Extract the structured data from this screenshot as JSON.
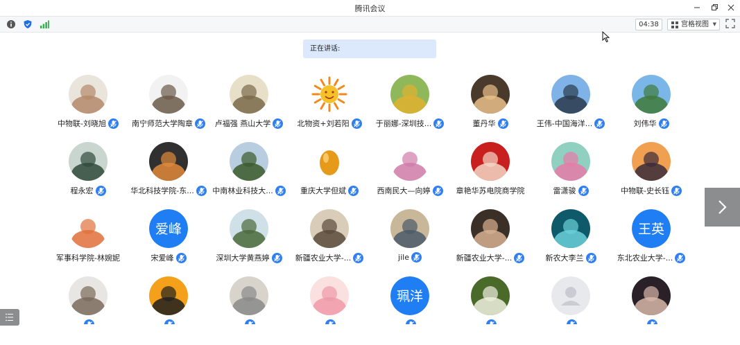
{
  "window": {
    "title": "腾讯会议"
  },
  "toolbar": {
    "timer": "04:38",
    "view_label": "宫格视图"
  },
  "speaking": {
    "label": "正在讲话:"
  },
  "participants": [
    {
      "name": "中物联-刘晓旭",
      "av": "photo",
      "c1": "#e9e4dc",
      "c2": "#b48a6a",
      "muted": true
    },
    {
      "name": "南宁师范大学陶章",
      "av": "photo",
      "c1": "#f2f2f2",
      "c2": "#6b5a49",
      "muted": true
    },
    {
      "name": "卢福强 燕山大学",
      "av": "photo",
      "c1": "#e8dfc8",
      "c2": "#7a6a4a",
      "muted": true
    },
    {
      "name": "北物资+刘若阳",
      "av": "sun",
      "c1": "#ffffff",
      "c2": "#f5a623",
      "muted": true
    },
    {
      "name": "于丽娜-深圳技...",
      "av": "photo",
      "c1": "#8fb85a",
      "c2": "#e0b030",
      "muted": true
    },
    {
      "name": "董丹华",
      "av": "photo",
      "c1": "#4a3a2c",
      "c2": "#e9c08a",
      "muted": true
    },
    {
      "name": "王伟-中国海洋...",
      "av": "photo",
      "c1": "#7fb3e8",
      "c2": "#2a3a4a",
      "muted": true
    },
    {
      "name": "刘伟华",
      "av": "photo",
      "c1": "#7ab7e8",
      "c2": "#3f7a3a",
      "muted": true
    },
    {
      "name": "程永宏",
      "av": "photo",
      "c1": "#c9d6cf",
      "c2": "#2f4a3a",
      "muted": true
    },
    {
      "name": "华北科技学院-东...",
      "av": "photo",
      "c1": "#303030",
      "c2": "#e08a3a",
      "muted": true
    },
    {
      "name": "中南林业科技大...",
      "av": "photo",
      "c1": "#b9cde0",
      "c2": "#3a5a2a",
      "muted": true
    },
    {
      "name": "重庆大学但斌",
      "av": "egg",
      "c1": "#ffffff",
      "c2": "#e59a1a",
      "muted": true
    },
    {
      "name": "西南民大—向婷",
      "av": "photo",
      "c1": "#ffffff",
      "c2": "#d07aa8",
      "muted": true
    },
    {
      "name": "章艳华苏电院商学院",
      "av": "photo",
      "c1": "#c8201f",
      "c2": "#f2d7c6",
      "muted": false
    },
    {
      "name": "雷潇骏",
      "av": "photo",
      "c1": "#8fd0c0",
      "c2": "#e87aa8",
      "muted": true
    },
    {
      "name": "中物联-史长钰",
      "av": "photo",
      "c1": "#f0a050",
      "c2": "#3a2a3a",
      "muted": true
    },
    {
      "name": "军事科学院-林婉妮",
      "av": "photo",
      "c1": "#ffffff",
      "c2": "#e0703a",
      "muted": false
    },
    {
      "name": "宋爱峰",
      "av": "text",
      "avtext": "爱峰",
      "c1": "#1f7ef4",
      "c2": "#ffffff",
      "muted": true
    },
    {
      "name": "深圳大学黄燕婷",
      "av": "photo",
      "c1": "#cfe0e8",
      "c2": "#4a6a3a",
      "muted": true
    },
    {
      "name": "新疆农业大学-...",
      "av": "photo",
      "c1": "#d9ccb9",
      "c2": "#5a4a3a",
      "muted": true
    },
    {
      "name": "jile",
      "av": "photo",
      "c1": "#c9b79a",
      "c2": "#4a5a6a",
      "muted": true
    },
    {
      "name": "新疆农业大学-...",
      "av": "photo",
      "c1": "#3a3028",
      "c2": "#d8b090",
      "muted": true
    },
    {
      "name": "新农大李兰",
      "av": "photo",
      "c1": "#0f5a6a",
      "c2": "#6ad0d8",
      "muted": true
    },
    {
      "name": "东北农业大学-...",
      "av": "text",
      "avtext": "王英",
      "c1": "#1f7ef4",
      "c2": "#ffffff",
      "muted": true
    },
    {
      "name": "",
      "av": "photo",
      "c1": "#e8e6e2",
      "c2": "#7a6a5a",
      "muted": true
    },
    {
      "name": "",
      "av": "photo",
      "c1": "#f5a01a",
      "c2": "#202020",
      "muted": true
    },
    {
      "name": "",
      "av": "photo",
      "c1": "#d8d4cc",
      "c2": "#8a8a8a",
      "muted": true
    },
    {
      "name": "",
      "av": "photo",
      "c1": "#fbe0e0",
      "c2": "#f09aa8",
      "muted": true
    },
    {
      "name": "",
      "av": "text",
      "avtext": "珮洋",
      "c1": "#1f7ef4",
      "c2": "#ffffff",
      "muted": true
    },
    {
      "name": "",
      "av": "photo",
      "c1": "#4a6a2a",
      "c2": "#f0f0e0",
      "muted": true
    },
    {
      "name": "",
      "av": "default",
      "c1": "#e8e9ec",
      "c2": "#c9ccd2",
      "muted": true
    },
    {
      "name": "",
      "av": "photo",
      "c1": "#2a2028",
      "c2": "#d8b8a8",
      "muted": true
    }
  ],
  "colors": {
    "mic_badge": "#2f7ff2",
    "speaking_bg": "#dce8fb",
    "toolbar_bg": "#f6f7f9",
    "text_avatar": "#1f7ef4"
  }
}
